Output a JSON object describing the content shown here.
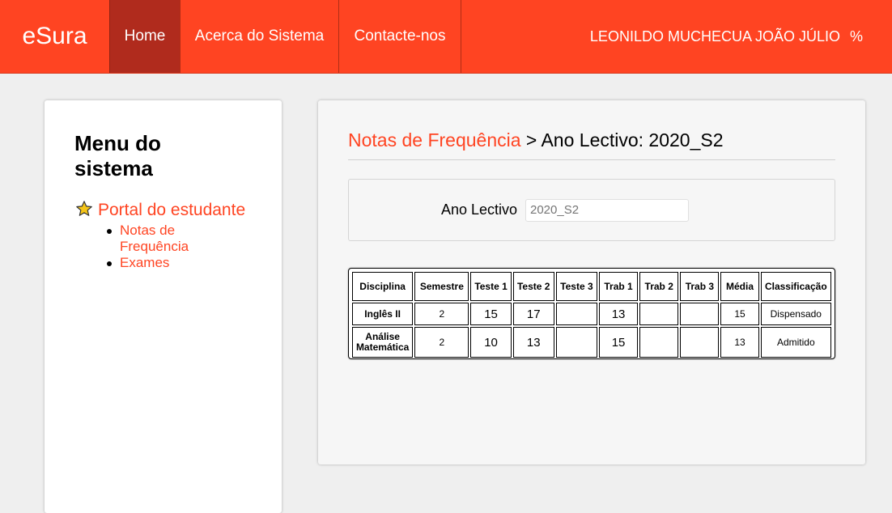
{
  "app": {
    "brand": "eSura",
    "nav": {
      "home": "Home",
      "about": "Acerca do Sistema",
      "contact": "Contacte-nos"
    },
    "user": {
      "name": "LEONILDO MUCHECUA JOÃO JÚLIO",
      "suffix": "%"
    }
  },
  "sidebar": {
    "title": "Menu do sistema",
    "portal_label": "Portal do estudante",
    "items": [
      {
        "label": "Notas de Frequência"
      },
      {
        "label": "Exames"
      }
    ]
  },
  "main": {
    "title_link": "Notas de Frequência",
    "title_rest": " > Ano Lectivo: 2020_S2",
    "filter": {
      "label": "Ano Lectivo",
      "placeholder": "2020_S2",
      "value": ""
    },
    "table": {
      "headers": [
        "Disciplina",
        "Semestre",
        "Teste 1",
        "Teste 2",
        "Teste 3",
        "Trab 1",
        "Trab 2",
        "Trab 3",
        "Média",
        "Classificação"
      ],
      "rows": [
        {
          "disciplina": "Inglês II",
          "semestre": "2",
          "teste1": "15",
          "teste2": "17",
          "teste3": "",
          "trab1": "13",
          "trab2": "",
          "trab3": "",
          "media": "15",
          "classificacao": "Dispensado"
        },
        {
          "disciplina": "Análise Matemática",
          "semestre": "2",
          "teste1": "10",
          "teste2": "13",
          "teste3": "",
          "trab1": "15",
          "trab2": "",
          "trab3": "",
          "media": "13",
          "classificacao": "Admitido"
        }
      ]
    }
  },
  "colors": {
    "accent": "#ff4422",
    "nav_active": "#b02b1d",
    "background": "#efefef"
  }
}
